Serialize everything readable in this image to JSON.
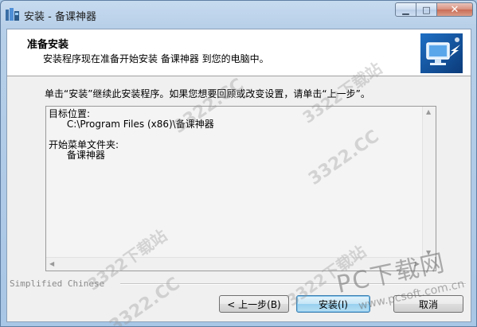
{
  "window": {
    "title": "安装 - 备课神器",
    "minimize_symbol": "▁",
    "maximize_symbol": "□",
    "close_symbol": "✕"
  },
  "header": {
    "title": "准备安装",
    "subtitle": "安装程序现在准备开始安装 备课神器 到您的电脑中。"
  },
  "body": {
    "instruction": "单击“安装”继续此安装程序。如果您想要回顾或改变设置，请单击“上一步”。",
    "summary": {
      "dest_label": "目标位置:",
      "dest_value": "C:\\Program Files (x86)\\备课神器",
      "startmenu_label": "开始菜单文件夹:",
      "startmenu_value": "备课神器"
    }
  },
  "footer": {
    "brand": "Simplified Chinese",
    "back_label": "< 上一步(B)",
    "install_label": "安装(I)",
    "cancel_label": "取消"
  },
  "watermarks": {
    "site1": "3322.CC",
    "site1_cn": "3322下载站",
    "pc_brand": "PC下载网",
    "pc_url": "www.pcsoft.com.cn"
  }
}
